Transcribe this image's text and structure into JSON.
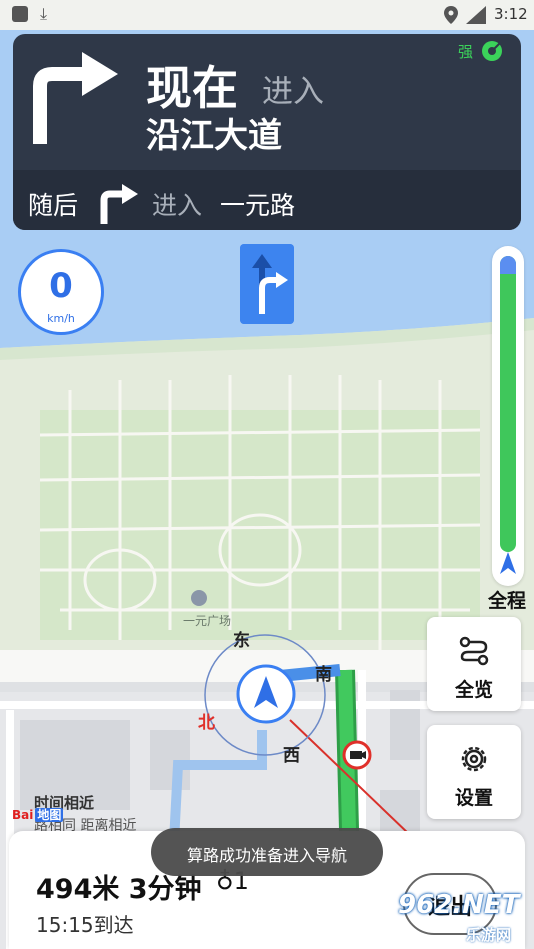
{
  "status_bar": {
    "time": "3:12"
  },
  "guidance": {
    "now": "现在",
    "enter": "进入",
    "road": "沿江大道",
    "signal": "强",
    "then_label": "随后",
    "then_enter": "进入",
    "then_road": "一元路"
  },
  "speed": {
    "value": "0",
    "unit": "km/h"
  },
  "progress": {
    "label": "全程"
  },
  "buttons": {
    "overview": "全览",
    "settings": "设置"
  },
  "compass": {
    "east": "东",
    "south": "南",
    "north": "北",
    "west": "西"
  },
  "map": {
    "poi": "一元广场",
    "logo_text": "Bai",
    "logo_badge": "地图"
  },
  "tooltip": {
    "title": "时间相近",
    "subtitle": "路相同 距离相近"
  },
  "trip": {
    "remaining": "494米 3分钟",
    "lights": "1",
    "arrival": "15:15到达",
    "exit": "退出"
  },
  "toast": "算路成功准备进入导航",
  "watermark": {
    "main": "962.NET",
    "sub": "乐游网"
  },
  "colors": {
    "route": "#30c55a",
    "accent": "#3a7ff2",
    "card": "#2f3848",
    "alert": "#e0302a"
  },
  "icons": [
    "download-icon",
    "location-pin-icon",
    "signal-icon",
    "turn-right-arrow-icon",
    "lane-arrow-icon",
    "car-arrow-icon",
    "route-icon",
    "gear-icon",
    "camera-icon",
    "traffic-light-icon"
  ]
}
